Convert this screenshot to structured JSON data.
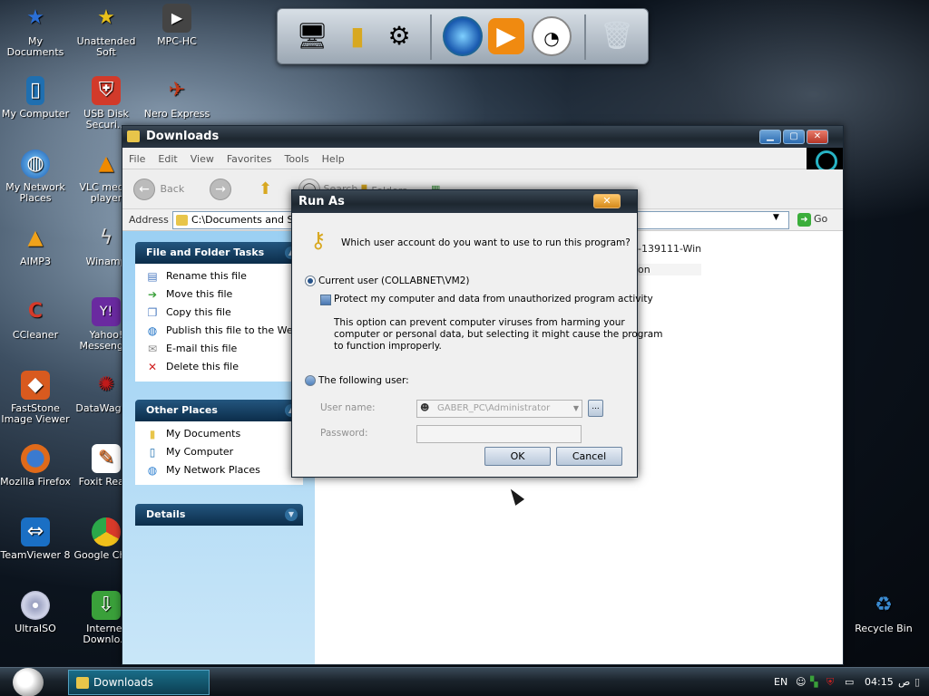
{
  "desktop": {
    "icons": [
      {
        "label": "My Documents",
        "icon": "star-icon",
        "color": "#2b6fd6"
      },
      {
        "label": "My Computer",
        "icon": "computer-icon",
        "color": "#1f6fb0"
      },
      {
        "label": "My Network Places",
        "icon": "globe-icon",
        "color": "#2c7fd0"
      },
      {
        "label": "AIMP3",
        "icon": "aimp-icon",
        "color": "#f0a21a"
      },
      {
        "label": "CCleaner",
        "icon": "ccleaner-icon",
        "color": "#d63a2a"
      },
      {
        "label": "FastStone Image Viewer",
        "icon": "faststone-icon",
        "color": "#d85a1f"
      },
      {
        "label": "Mozilla Firefox",
        "icon": "firefox-icon",
        "color": "#e06a1a"
      },
      {
        "label": "TeamViewer 8",
        "icon": "teamviewer-icon",
        "color": "#1a6fc4"
      },
      {
        "label": "UltraISO",
        "icon": "disc-icon",
        "color": "#8a8a9a"
      },
      {
        "label": "Unattended Soft",
        "icon": "star-icon",
        "color": "#e8c01a"
      },
      {
        "label": "USB Disk Securi...",
        "icon": "shield-icon",
        "color": "#d23a2a"
      },
      {
        "label": "VLC media player",
        "icon": "vlc-cone-icon",
        "color": "#f08a00"
      },
      {
        "label": "Winamp",
        "icon": "winamp-icon",
        "color": "#d0d0d0"
      },
      {
        "label": "Yahoo! Messeng...",
        "icon": "yahoo-icon",
        "color": "#6a2aa0"
      },
      {
        "label": "DataWago...",
        "icon": "datawagon-icon",
        "color": "#c01a1a"
      },
      {
        "label": "Foxit Rea...",
        "icon": "foxit-icon",
        "color": "#e86a1a"
      },
      {
        "label": "Google Chr...",
        "icon": "chrome-icon",
        "color": "#2ba84a"
      },
      {
        "label": "Internet Downlo...",
        "icon": "idm-icon",
        "color": "#3aa03a"
      },
      {
        "label": "MPC-HC",
        "icon": "clapper-icon",
        "color": "#444444"
      },
      {
        "label": "Nero Express",
        "icon": "nero-icon",
        "color": "#c03a1a"
      },
      {
        "label": "Recycle Bin",
        "icon": "recycle-bin-icon",
        "color": "#3a8ad0"
      }
    ]
  },
  "dock": {
    "items": [
      "monitor-icon",
      "folder-icon",
      "control-panel-icon",
      "globe-icon",
      "media-player-icon",
      "clock-icon",
      "trash-icon"
    ]
  },
  "explorer": {
    "title": "Downloads",
    "menu": [
      "File",
      "Edit",
      "View",
      "Favorites",
      "Tools",
      "Help"
    ],
    "toolbar": {
      "back": "Back",
      "search": "Search",
      "folders": "Folders"
    },
    "address": {
      "label": "Address",
      "value": "C:\\Documents and Set",
      "go": "Go"
    },
    "file_tasks": {
      "title": "File and Folder Tasks",
      "items": [
        "Rename this file",
        "Move this file",
        "Copy this file",
        "Publish this file to the Web",
        "E-mail this file",
        "Delete this file"
      ]
    },
    "other_places": {
      "title": "Other Places",
      "items": [
        "My Documents",
        "My Computer",
        "My Network Places"
      ]
    },
    "details": {
      "title": "Details"
    },
    "files": [
      "-139111-Win",
      "on"
    ]
  },
  "runas": {
    "title": "Run As",
    "question": "Which user account do you want to use to run this program?",
    "current_user": "Current user (COLLABNET\\VM2)",
    "protect": "Protect my computer and data from unauthorized program activity",
    "note_lines": [
      "This option can prevent computer viruses from harming your",
      "computer or personal data, but selecting it might cause the program",
      "to function improperly."
    ],
    "following_user": "The following user:",
    "username_label": "User name:",
    "username_value": "GABER_PC\\Administrator",
    "password_label": "Password:",
    "ok": "OK",
    "cancel": "Cancel"
  },
  "taskbar": {
    "task": "Downloads",
    "lang": "EN",
    "time": "04:15",
    "ampm": "ص"
  }
}
